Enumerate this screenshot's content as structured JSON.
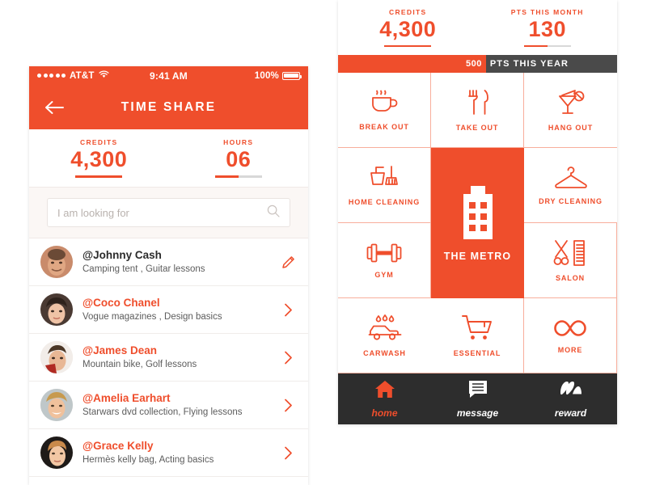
{
  "left_phone": {
    "status_bar": {
      "carrier": "AT&T",
      "time": "9:41 AM",
      "battery": "100%",
      "signal_dots": 5,
      "wifi_icon": "wifi-icon"
    },
    "nav": {
      "title": "TIME SHARE",
      "back_icon": "arrow-left-icon"
    },
    "stats": [
      {
        "label": "CREDITS",
        "value": "4,300",
        "fill_percent": 100
      },
      {
        "label": "HOURS",
        "value": "06",
        "fill_percent": 50
      }
    ],
    "search": {
      "placeholder": "I am looking for",
      "value": "",
      "icon": "search-icon"
    },
    "list": [
      {
        "name": "@Johnny Cash",
        "detail": "Camping tent , Guitar lessons",
        "action_icon": "pencil-icon",
        "highlight": false
      },
      {
        "name": "@Coco Chanel",
        "detail": "Vogue magazines , Design basics",
        "action_icon": "chevron-right-icon",
        "highlight": true
      },
      {
        "name": "@James Dean",
        "detail": "Mountain bike, Golf lessons",
        "action_icon": "chevron-right-icon",
        "highlight": true
      },
      {
        "name": "@Amelia Earhart",
        "detail": "Starwars dvd collection, Flying lessons",
        "action_icon": "chevron-right-icon",
        "highlight": true
      },
      {
        "name": "@Grace Kelly",
        "detail": "Hermès kelly bag, Acting basics",
        "action_icon": "chevron-right-icon",
        "highlight": true
      }
    ]
  },
  "right_phone": {
    "stats": [
      {
        "label": "CREDITS",
        "value": "4,300",
        "fill_percent": 100
      },
      {
        "label": "PTS THIS MONTH",
        "value": "130",
        "fill_percent": 50
      }
    ],
    "progress": {
      "value": "500",
      "label": "PTS THIS YEAR",
      "fill_percent": 53
    },
    "tiles": [
      {
        "label": "BREAK OUT",
        "icon": "coffee-cup-icon"
      },
      {
        "label": "TAKE OUT",
        "icon": "fork-knife-icon"
      },
      {
        "label": "HANG OUT",
        "icon": "cocktail-icon"
      },
      {
        "label": "HOME CLEANING",
        "icon": "bucket-broom-icon"
      },
      {
        "label": "DRY CLEANING",
        "icon": "hanger-icon"
      },
      {
        "label": "GYM",
        "icon": "dumbbell-icon"
      },
      {
        "label": "SALON",
        "icon": "scissors-comb-icon"
      },
      {
        "label": "CARWASH",
        "icon": "car-wash-icon"
      },
      {
        "label": "ESSENTIAL",
        "icon": "shopping-cart-icon"
      },
      {
        "label": "MORE",
        "icon": "infinity-icon"
      }
    ],
    "metro_tile": {
      "label": "THE METRO",
      "icon": "building-icon"
    },
    "tabs": [
      {
        "label": "home",
        "icon": "home-icon",
        "active": true
      },
      {
        "label": "message",
        "icon": "message-icon",
        "active": false
      },
      {
        "label": "reward",
        "icon": "reward-icon",
        "active": false
      }
    ]
  },
  "colors": {
    "accent": "#EF4E2C",
    "dark": "#2D2D2D",
    "bar_gray": "#4A4A4A",
    "grid_line": "#F8AE9C"
  }
}
